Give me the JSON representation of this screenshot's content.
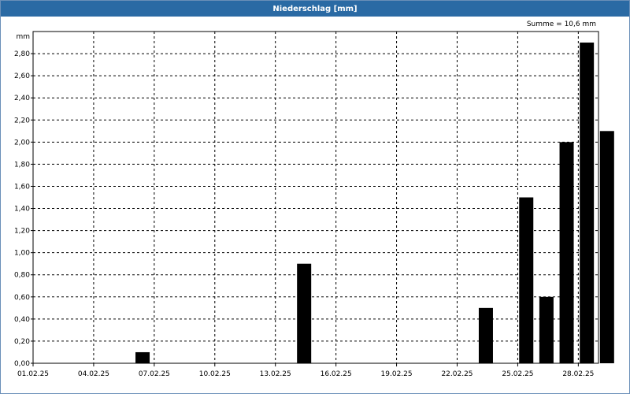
{
  "window": {
    "title": "Niederschlag [mm]"
  },
  "summary": "Summe = 10,6 mm",
  "colors": {
    "titlebar": "#2a6aa4",
    "bars": "#000000",
    "grid": "#000000"
  },
  "chart_data": {
    "type": "bar",
    "title": "Niederschlag [mm]",
    "ylabel": "mm",
    "xlabel": "",
    "grid": true,
    "ylim": [
      0,
      3.0
    ],
    "yticks": [
      "0,00",
      "0,20",
      "0,40",
      "0,60",
      "0,80",
      "1,00",
      "1,20",
      "1,40",
      "1,60",
      "1,80",
      "2,00",
      "2,20",
      "2,40",
      "2,60",
      "2,80"
    ],
    "xticks": [
      "01.02.25",
      "04.02.25",
      "07.02.25",
      "10.02.25",
      "13.02.25",
      "16.02.25",
      "19.02.25",
      "22.02.25",
      "25.02.25",
      "28.02.25"
    ],
    "x": [
      "01.02.25",
      "02.02.25",
      "03.02.25",
      "04.02.25",
      "05.02.25",
      "06.02.25",
      "07.02.25",
      "08.02.25",
      "09.02.25",
      "10.02.25",
      "11.02.25",
      "12.02.25",
      "13.02.25",
      "14.02.25",
      "15.02.25",
      "16.02.25",
      "17.02.25",
      "18.02.25",
      "19.02.25",
      "20.02.25",
      "21.02.25",
      "22.02.25",
      "23.02.25",
      "24.02.25",
      "25.02.25",
      "26.02.25",
      "27.02.25",
      "28.02.25"
    ],
    "values": [
      0,
      0,
      0,
      0,
      0,
      0.1,
      0,
      0,
      0,
      0,
      0,
      0,
      0,
      0.9,
      0,
      0,
      0,
      0,
      0,
      0,
      0,
      0,
      0.5,
      0,
      1.5,
      0.6,
      2.0,
      2.9,
      2.1
    ]
  }
}
